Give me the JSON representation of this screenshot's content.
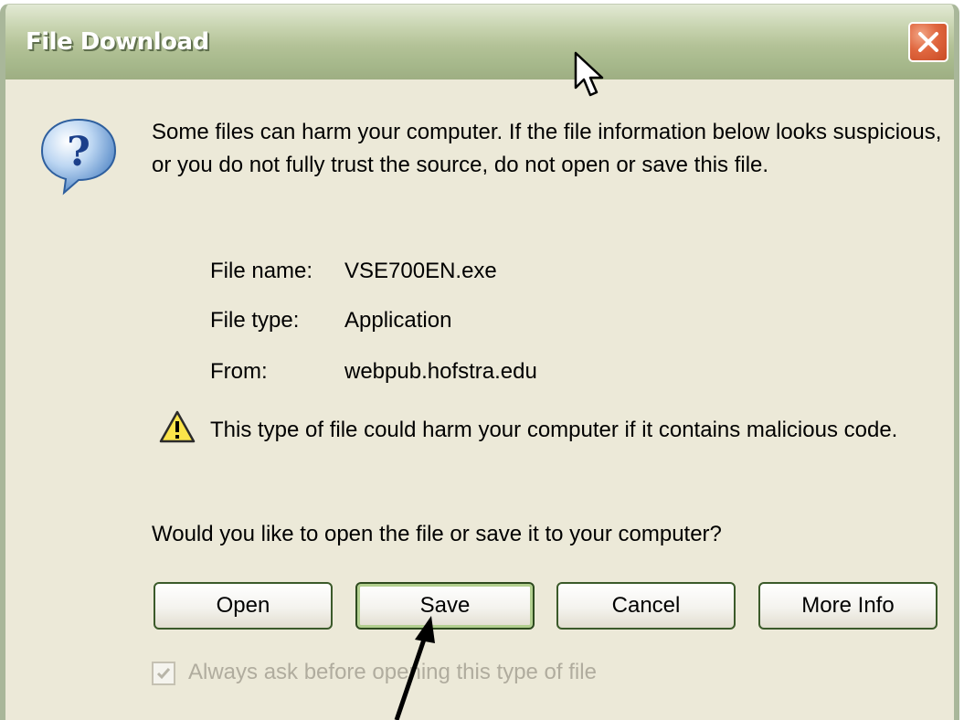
{
  "window": {
    "title": "File Download"
  },
  "message": "Some files can harm your computer. If the file information below looks suspicious, or you do not fully trust the source, do not open or save this file.",
  "file_info": {
    "name_label": "File name:",
    "name_value": "VSE700EN.exe",
    "type_label": "File type:",
    "type_value": "Application",
    "from_label": "From:",
    "from_value": "webpub.hofstra.edu"
  },
  "warning": "This type of file could harm your computer if it contains malicious code.",
  "question": "Would you like to open the file or save it to your computer?",
  "buttons": {
    "open": "Open",
    "save": "Save",
    "cancel": "Cancel",
    "more_info": "More Info"
  },
  "checkbox": {
    "label": "Always ask before opening this type of file",
    "checked": true,
    "enabled": false
  },
  "icons": {
    "dialog": "question-bubble-icon",
    "warning": "warning-triangle-icon",
    "close": "close-icon"
  },
  "colors": {
    "title_bar": "#b3c297",
    "dialog_background": "#ece9d8",
    "close_button": "#e0673f",
    "default_button_ring": "#b2cf8f"
  }
}
